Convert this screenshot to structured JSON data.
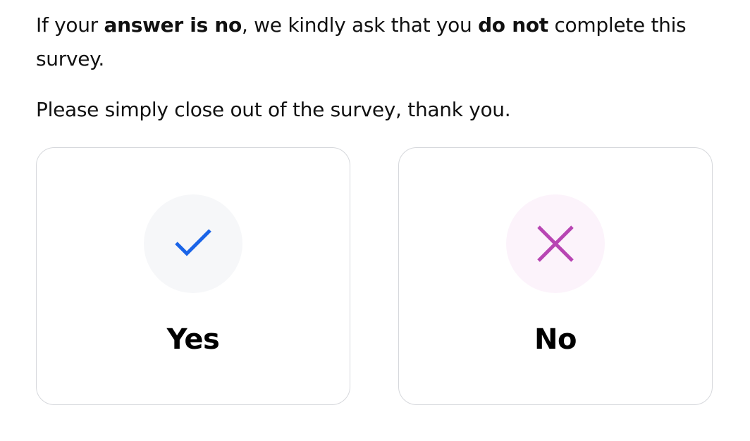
{
  "intro": {
    "p1_before": "If your ",
    "p1_bold1": "answer is no",
    "p1_middle": ", we kindly ask that you ",
    "p1_bold2": "do not",
    "p1_after": " complete this survey.",
    "p2": "Please simply close out of the survey, thank you."
  },
  "options": {
    "yes": {
      "label": "Yes",
      "icon": "checkmark-icon",
      "color": "#1a64e8"
    },
    "no": {
      "label": "No",
      "icon": "close-icon",
      "color": "#b845b3"
    }
  }
}
